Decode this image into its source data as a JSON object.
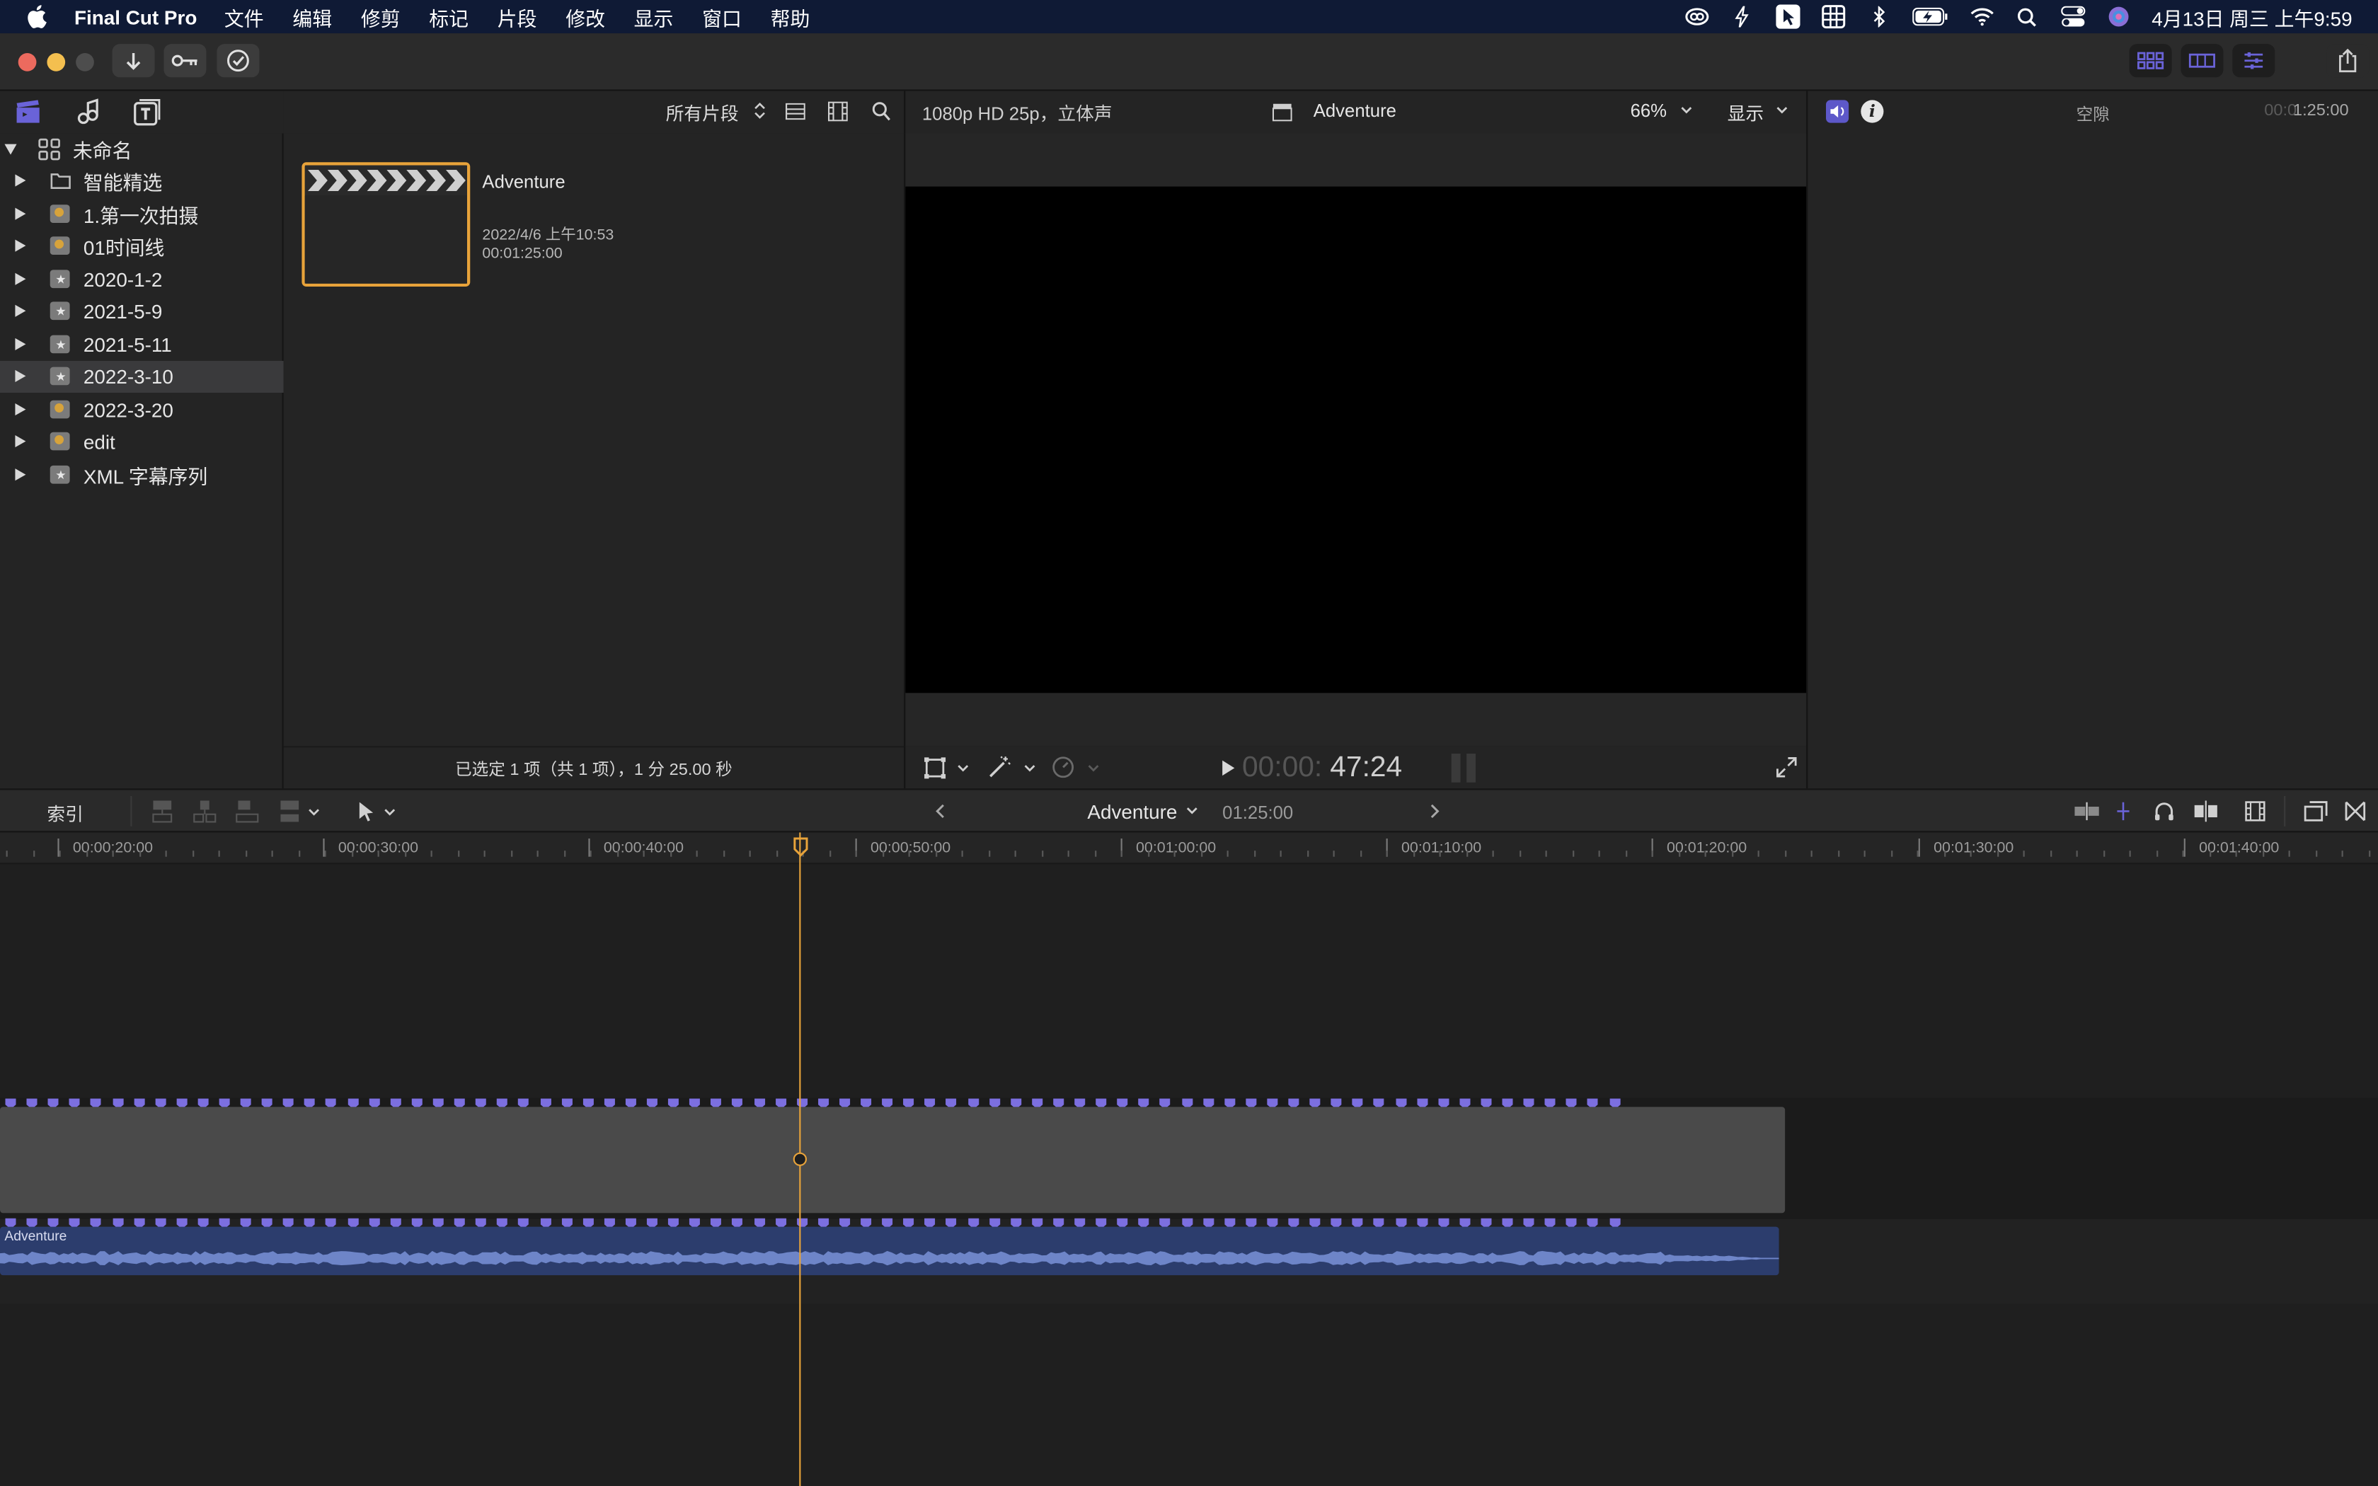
{
  "menubar": {
    "app_name": "Final Cut Pro",
    "menus": [
      "文件",
      "编辑",
      "修剪",
      "标记",
      "片段",
      "修改",
      "显示",
      "窗口",
      "帮助"
    ],
    "clock": "4月13日 周三 上午9:59"
  },
  "library": {
    "root_name": "未命名",
    "items": [
      {
        "label": "智能精选",
        "icon": "folder-icon"
      },
      {
        "label": "1.第一次拍摄",
        "icon": "event-icon"
      },
      {
        "label": "01时间线",
        "icon": "event-icon"
      },
      {
        "label": "2020-1-2",
        "icon": "event-icon"
      },
      {
        "label": "2021-5-9",
        "icon": "event-icon"
      },
      {
        "label": "2021-5-11",
        "icon": "event-icon"
      },
      {
        "label": "2022-3-10",
        "icon": "event-icon",
        "selected": true
      },
      {
        "label": "2022-3-20",
        "icon": "event-icon"
      },
      {
        "label": "edit",
        "icon": "event-icon"
      },
      {
        "label": "XML 字幕序列",
        "icon": "event-icon"
      }
    ]
  },
  "browser": {
    "filter_label": "所有片段",
    "clip": {
      "name": "Adventure",
      "date": "2022/4/6 上午10:53",
      "duration": "00:01:25:00"
    },
    "footer": "已选定 1 项（共 1 项），1 分 25.00 秒"
  },
  "viewer": {
    "format": "1080p HD 25p，立体声",
    "project_name": "Adventure",
    "zoom": "66%",
    "display_label": "显示",
    "timecode_dim": "00:00:",
    "timecode_bright": "47:24"
  },
  "inspector": {
    "title": "空隙",
    "timecode_dim": "00:0",
    "timecode": "1:25:00"
  },
  "timeline": {
    "index_label": "索引",
    "project_name": "Adventure",
    "duration": "01:25:00",
    "ruler_labels": [
      "00:00:20:00",
      "00:00:30:00",
      "00:00:40:00",
      "00:00:50:00",
      "00:01:00:00",
      "00:01:10:00",
      "00:01:20:00",
      "00:01:30:00",
      "00:01:40:00"
    ],
    "audio_clip_name": "Adventure"
  },
  "colors": {
    "accent_orange": "#e8a33a",
    "marker_purple": "#7c6fe0",
    "audio_blue": "#3a4f8a",
    "menubar_bg": "#0f1a35"
  }
}
